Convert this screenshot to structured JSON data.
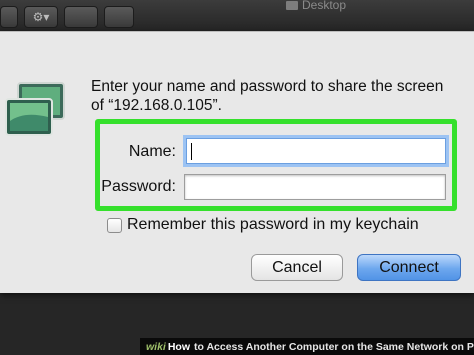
{
  "toolbar": {
    "gear_menu": "⚙▾",
    "window_title": "Desktop"
  },
  "dialog": {
    "message": "Enter your name and password to share the screen of “192.168.0.105”.",
    "name_label": "Name:",
    "name_value": "",
    "password_label": "Password:",
    "password_value": "",
    "remember_label": "Remember this password in my keychain",
    "remember_checked": false,
    "cancel_label": "Cancel",
    "connect_label": "Connect",
    "highlight_color": "#35e02c",
    "default_button_color": "#5a9ae8"
  },
  "caption": {
    "wiki": "wiki",
    "how": "How",
    "text": "to Access Another Computer on the Same Network on PC or Mac"
  }
}
